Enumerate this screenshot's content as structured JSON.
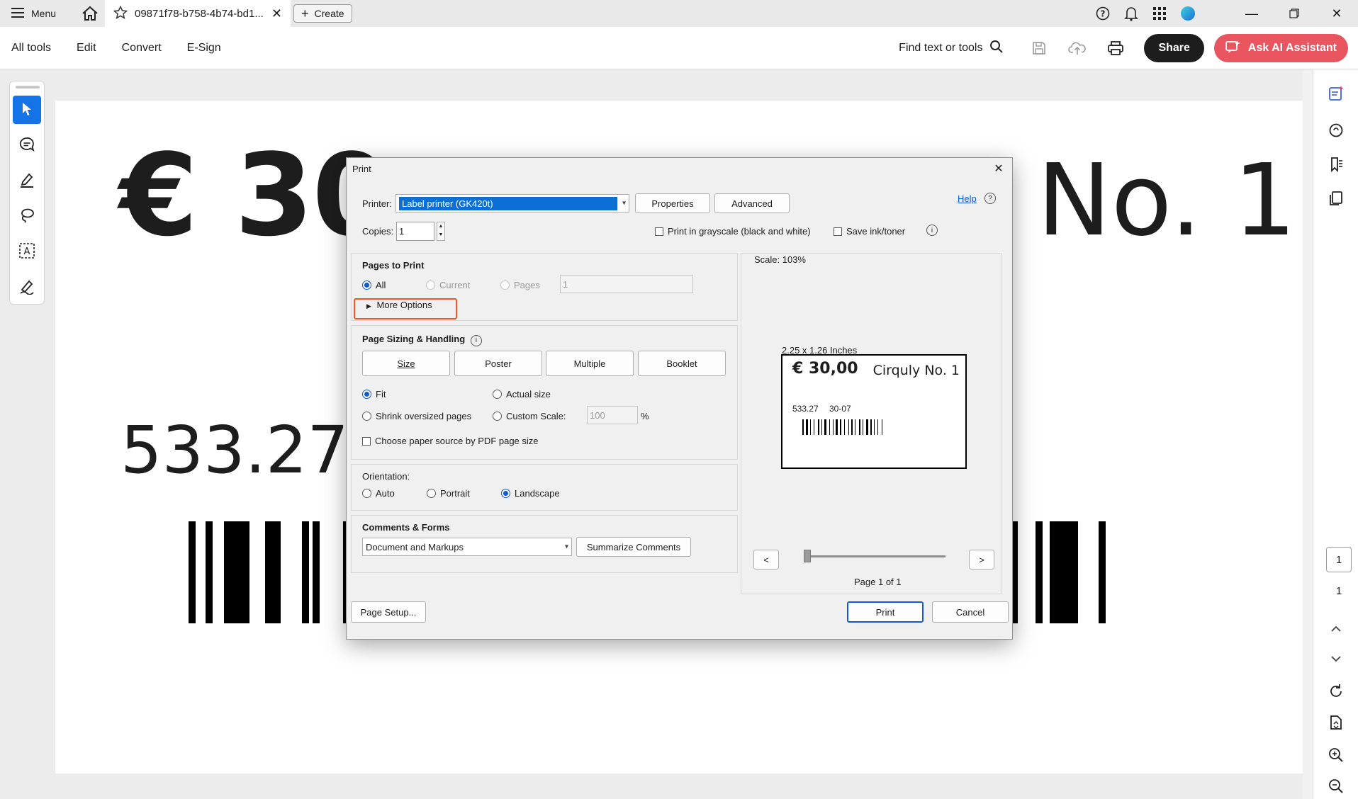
{
  "tabbar": {
    "menu_label": "Menu",
    "doc_tab_title": "09871f78-b758-4b74-bd1...",
    "create_label": "Create"
  },
  "toolbar": {
    "items": [
      "All tools",
      "Edit",
      "Convert",
      "E-Sign"
    ],
    "find_label": "Find text or tools",
    "share_label": "Share",
    "ai_label": "Ask AI Assistant"
  },
  "document": {
    "price": "€ 30",
    "brand": "No. 1",
    "amount": "533.27"
  },
  "page_nav": {
    "current": "1",
    "total": "1"
  },
  "dialog": {
    "title": "Print",
    "printer_label": "Printer:",
    "printer_value": "Label printer (GK420t)",
    "properties_label": "Properties",
    "advanced_label": "Advanced",
    "help_label": "Help",
    "copies_label": "Copies:",
    "copies_value": "1",
    "grayscale_label": "Print in grayscale (black and white)",
    "save_ink_label": "Save ink/toner",
    "pages_to_print": {
      "heading": "Pages to Print",
      "all": "All",
      "current": "Current",
      "pages": "Pages",
      "pages_value": "1",
      "more_options": "More Options"
    },
    "sizing": {
      "heading": "Page Sizing & Handling",
      "tabs": [
        "Size",
        "Poster",
        "Multiple",
        "Booklet"
      ],
      "fit": "Fit",
      "actual_size": "Actual size",
      "shrink": "Shrink oversized pages",
      "custom_scale": "Custom Scale:",
      "custom_scale_value": "100",
      "percent": "%",
      "paper_source": "Choose paper source by PDF page size"
    },
    "orientation": {
      "heading": "Orientation:",
      "auto": "Auto",
      "portrait": "Portrait",
      "landscape": "Landscape"
    },
    "comments_forms": {
      "heading": "Comments & Forms",
      "select_value": "Document and Markups",
      "summarize_label": "Summarize Comments"
    },
    "preview": {
      "scale": "Scale: 103%",
      "dimensions": "2.25 x 1.26 Inches",
      "label_price": "€ 30,00",
      "label_brand": "Cirquly No. 1",
      "label_amount": "533.27",
      "label_code": "30-07",
      "prev": "<",
      "next": ">",
      "page_info": "Page 1 of 1"
    },
    "page_setup_label": "Page Setup...",
    "print_label": "Print",
    "cancel_label": "Cancel"
  }
}
